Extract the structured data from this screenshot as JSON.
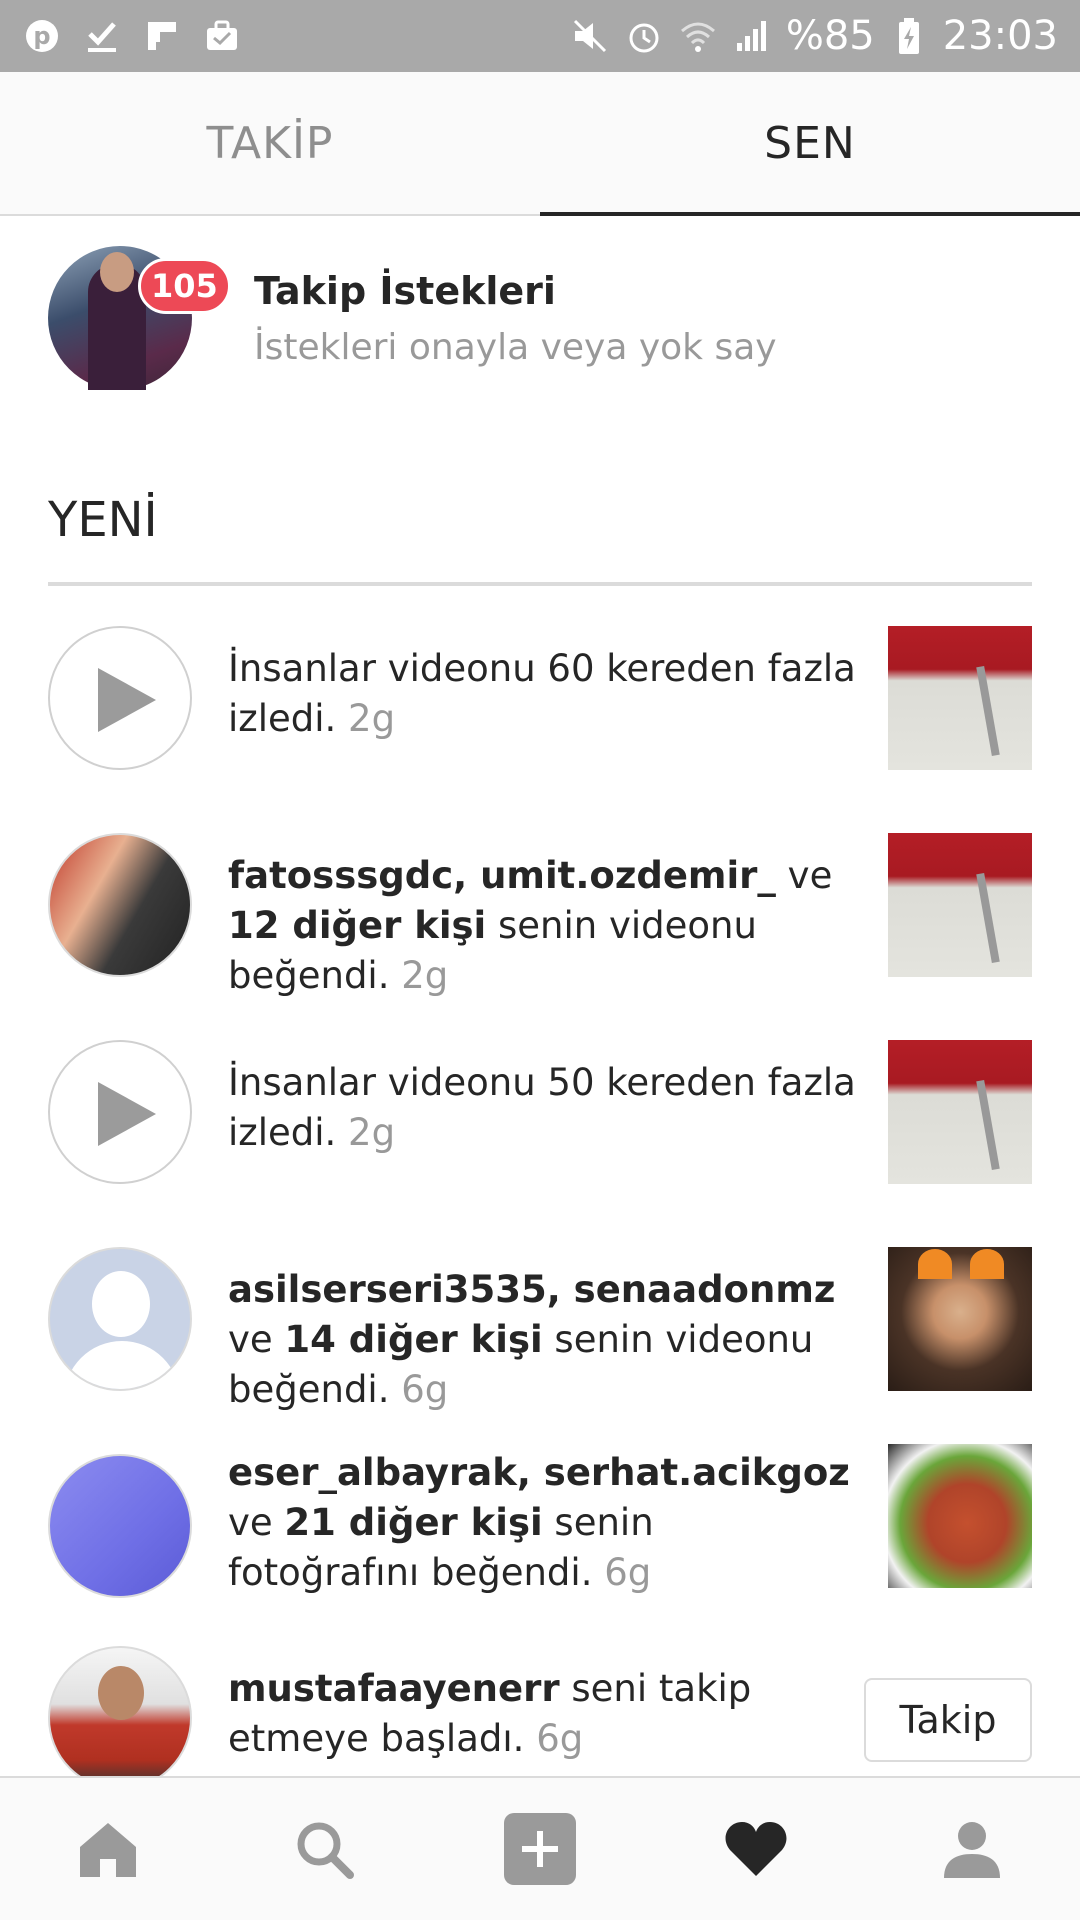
{
  "status_bar": {
    "battery": "%85",
    "time": "23:03"
  },
  "tabs": [
    {
      "label": "TAKİP"
    },
    {
      "label": "SEN"
    }
  ],
  "requests": {
    "badge": "105",
    "title": "Takip İstekleri",
    "subtitle": "İstekleri onayla veya yok say"
  },
  "section": {
    "title": "YENİ"
  },
  "notifications": [
    {
      "pre": "İnsanlar videonu 60 kereden fazla izledi.",
      "time": "2g"
    },
    {
      "users": "fatosssgdc, umit.ozdemir_",
      "mid": " ve ",
      "others": "12 diğer kişi",
      "post": " senin videonu beğendi.",
      "time": "2g"
    },
    {
      "pre": "İnsanlar videonu 50 kereden fazla izledi.",
      "time": "2g"
    },
    {
      "users": "asilserseri3535, senaadonmz",
      "mid": " ve ",
      "others": "14 diğer kişi",
      "post": " senin videonu beğendi.",
      "time": "6g"
    },
    {
      "users": "eser_albayrak, serhat.acikgoz",
      "mid": " ve ",
      "others": "21 diğer kişi",
      "post": " senin fotoğrafını beğendi.",
      "time": "6g"
    },
    {
      "users": "mustafaayenerr",
      "post": " seni takip etmeye başladı.",
      "time": "6g",
      "button": "Takip"
    }
  ]
}
